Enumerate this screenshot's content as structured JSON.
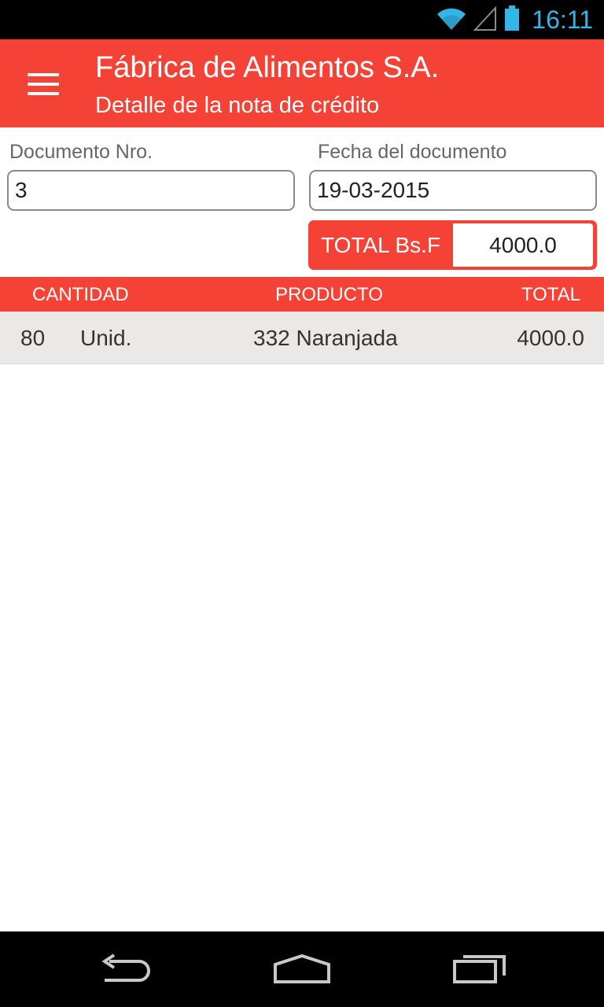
{
  "status_bar": {
    "time": "16:11",
    "icons": [
      "wifi-icon",
      "signal-icon",
      "battery-icon"
    ],
    "accent_color": "#33b5e5"
  },
  "app_bar": {
    "title": "Fábrica de Alimentos S.A.",
    "subtitle": "Detalle de la nota de crédito",
    "menu_icon": "hamburger-menu-icon",
    "color": "#f44336"
  },
  "form": {
    "doc_number_label": "Documento Nro.",
    "doc_number_value": "3",
    "doc_date_label": "Fecha del documento",
    "doc_date_value": "19-03-2015",
    "total_label": "TOTAL Bs.F",
    "total_value": "4000.0"
  },
  "table": {
    "headers": [
      "CANTIDAD",
      "PRODUCTO",
      "TOTAL"
    ],
    "rows": [
      {
        "qty": "80",
        "unit": "Unid.",
        "product": "332 Naranjada",
        "total": "4000.0"
      }
    ]
  },
  "nav_bar": {
    "icons": [
      "back-icon",
      "home-icon",
      "recent-apps-icon"
    ]
  }
}
